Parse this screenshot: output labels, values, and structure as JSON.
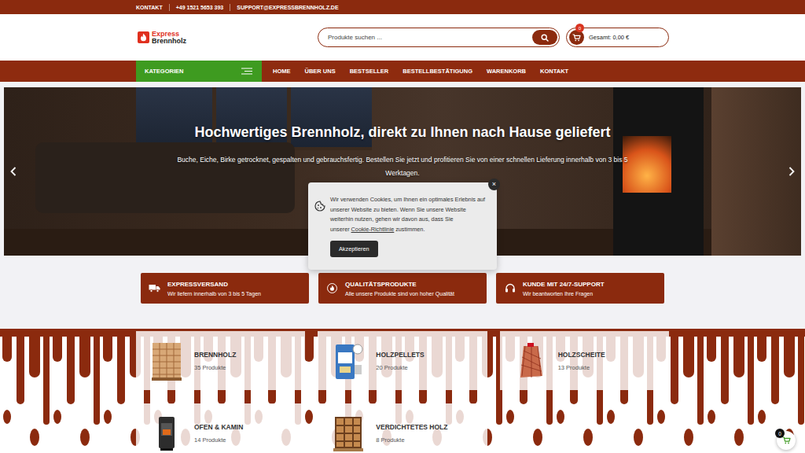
{
  "topbar": {
    "items": [
      "KONTAKT",
      "+49 1521 5653 393",
      "SUPPORT@EXPRESSBRENNHOLZ.DE"
    ]
  },
  "logo": {
    "line1": "Express",
    "line2": "Brennholz"
  },
  "search": {
    "placeholder": "Produkte suchen ..."
  },
  "cart": {
    "count": "0",
    "total": "Gesamt: 0,00 €"
  },
  "nav": {
    "categories": "KATEGORIEN",
    "items": [
      "HOME",
      "ÜBER UNS",
      "BESTSELLER",
      "BESTELLBESTÄTIGUNG",
      "WARENKORB",
      "KONTAKT"
    ]
  },
  "hero": {
    "title": "Hochwertiges Brennholz, direkt zu Ihnen nach Hause geliefert",
    "text": "Buche, Eiche, Birke getrocknet, gespalten und gebrauchsfertig. Bestellen Sie jetzt und profitieren Sie von einer schnellen Lieferung innerhalb von 3 bis 5 Werktagen."
  },
  "cookie": {
    "text": "Wir verwenden Cookies, um Ihnen ein optimales Erlebnis auf unserer Website zu bieten. Wenn Sie unsere Website weiterhin nutzen, gehen wir davon aus, dass Sie unserer",
    "link": "Cookie-Richtlinie",
    "text_end": "zustimmen.",
    "button": "Akzeptieren",
    "close": "×"
  },
  "features": [
    {
      "title": "EXPRESSVERSAND",
      "text": "Wir liefern innerhalb von 3 bis 5 Tagen",
      "kind": "truck"
    },
    {
      "title": "QUALITÄTSPRODUKTE",
      "text": "Alle unsere Produkte sind von hoher Qualität",
      "kind": "flame"
    },
    {
      "title": "KUNDE MIT 24/7-SUPPORT",
      "text": "Wir beantworten Ihre Fragen",
      "kind": "headset"
    }
  ],
  "categories": [
    {
      "name": "BRENNHOLZ",
      "count": "35 Produkte",
      "kind": "crate"
    },
    {
      "name": "HOLZPELLETS",
      "count": "20 Produkte",
      "kind": "pellets"
    },
    {
      "name": "HOLZSCHEITE",
      "count": "13 Produkte",
      "kind": "netbag"
    },
    {
      "name": "OFEN & KAMIN",
      "count": "14 Produkte",
      "kind": "stove"
    },
    {
      "name": "VERDICHTETES HOLZ",
      "count": "8 Produkte",
      "kind": "pallet"
    }
  ],
  "floating_cart": {
    "count": "0"
  }
}
